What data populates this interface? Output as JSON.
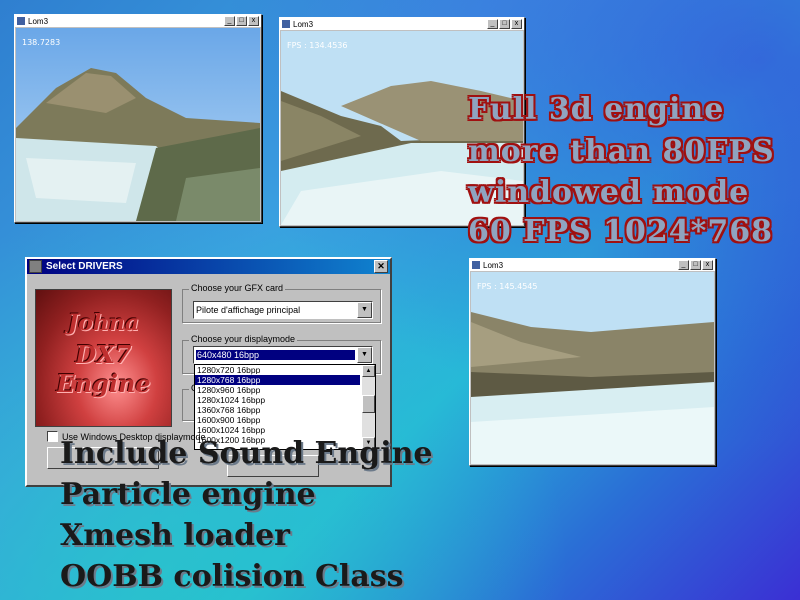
{
  "windows": [
    {
      "id": "w1",
      "title": "Lom3",
      "fps": "138.7283"
    },
    {
      "id": "w2",
      "title": "Lom3",
      "fps": "FPS : 134.4536"
    },
    {
      "id": "w3",
      "title": "Lom3",
      "fps": "FPS : 145.4545"
    }
  ],
  "promo": {
    "lines": [
      "Full 3d engine",
      "more than 80FPS",
      "windowed mode",
      "60 FPS 1024*768"
    ]
  },
  "dialog": {
    "title": "Select DRIVERS",
    "close": "✕",
    "logo_line1": "Johna",
    "logo_line2": "DX7 Engine",
    "gfx_group_label": "Choose your GFX card",
    "gfx_value": "Pilote d'affichage principal",
    "display_group_label": "Choose your displaymode",
    "display_value": "640x480 16bpp",
    "display_options": [
      "1280x720 16bpp",
      "1280x768 16bpp",
      "1280x960 16bpp",
      "1280x1024 16bpp",
      "1360x768 16bpp",
      "1600x900 16bpp",
      "1600x1024 16bpp",
      "1600x1200 16bpp"
    ],
    "display_options_selected_index": 1,
    "checkbox_label": "Use Windows Desktop displaymode",
    "third_group_label": "C"
  },
  "features": [
    "Include Sound Engine",
    "Particle engine",
    "Xmesh loader",
    "OOBB colision Class"
  ],
  "colors": {
    "titlebar_active": "#000080",
    "promo_outline": "#a01010",
    "window_face": "#c0c0c0"
  },
  "icons": {
    "minimize": "minimize-icon",
    "maximize": "maximize-icon",
    "close": "close-icon"
  }
}
